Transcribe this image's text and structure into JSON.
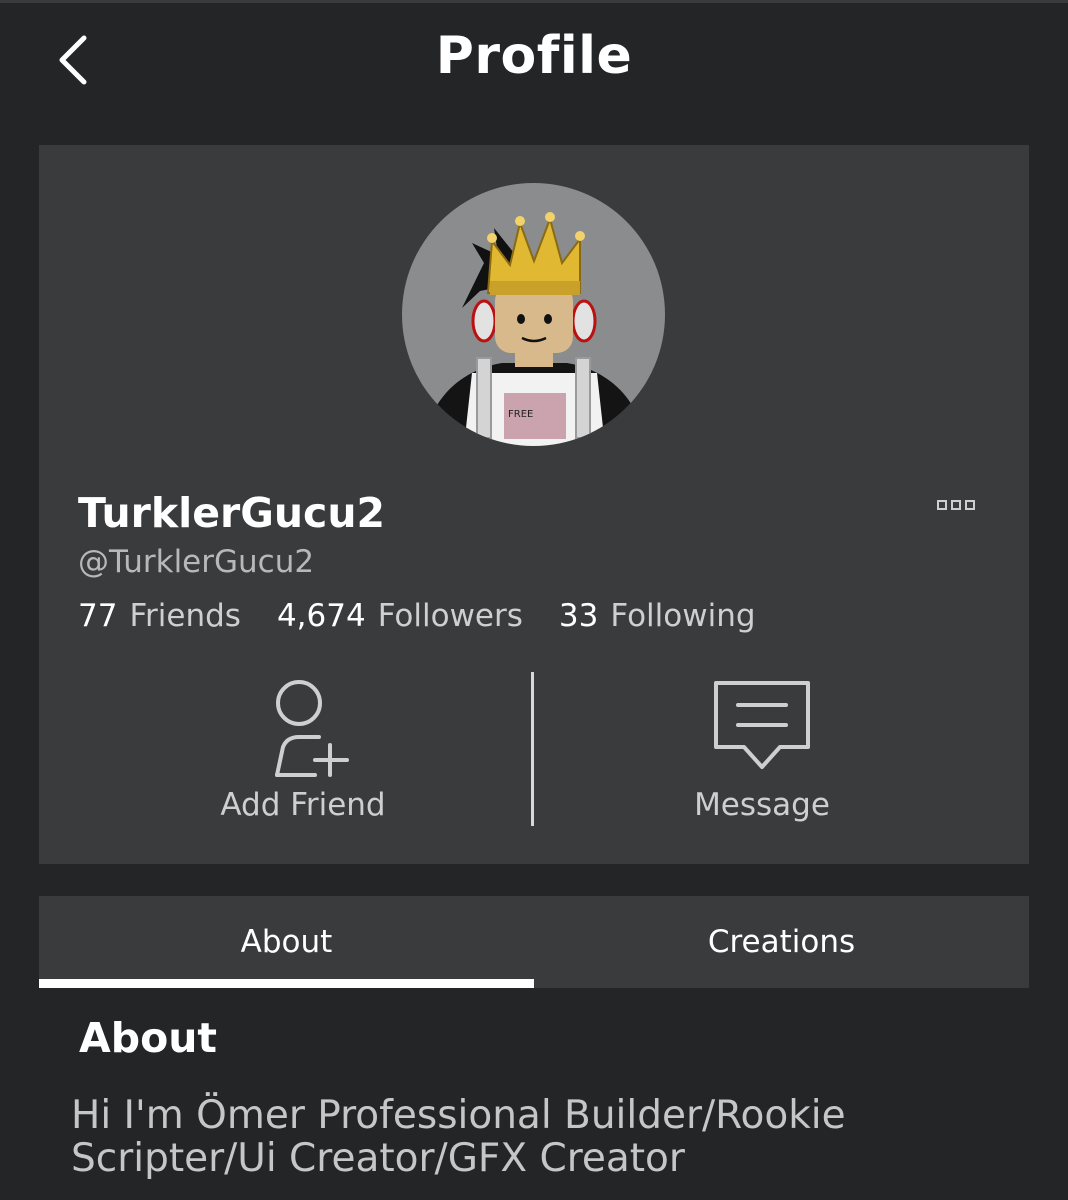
{
  "header": {
    "title": "Profile",
    "back_icon": "chevron-left-icon"
  },
  "profile": {
    "display_name": "TurklerGucu2",
    "username": "@TurklerGucu2",
    "avatar_icon": "avatar-crown-icon",
    "more_icon": "more-options-icon"
  },
  "stats": [
    {
      "value": "77",
      "label": "Friends"
    },
    {
      "value": "4,674",
      "label": "Followers"
    },
    {
      "value": "33",
      "label": "Following"
    }
  ],
  "actions": {
    "add_friend_label": "Add Friend",
    "add_friend_icon": "add-friend-icon",
    "message_label": "Message",
    "message_icon": "message-icon"
  },
  "tabs": [
    {
      "label": "About",
      "active": true
    },
    {
      "label": "Creations",
      "active": false
    }
  ],
  "about": {
    "heading": "About",
    "text": "Hi I'm Ömer Professional Builder/Rookie Scripter/Ui Creator/GFX Creator"
  },
  "colors": {
    "background": "#232527",
    "card": "#393b3d",
    "text_primary": "#ffffff",
    "text_secondary": "#cfcfcf"
  }
}
